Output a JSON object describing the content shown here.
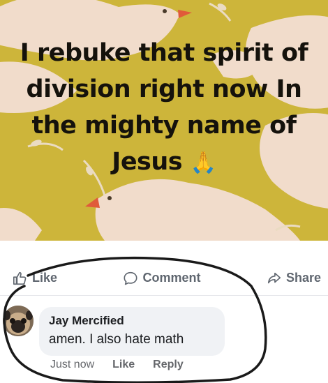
{
  "post": {
    "image_text": "I rebuke that spirit of division right now In the mighty name of Jesus",
    "emoji": "🙏",
    "colors": {
      "background": "#cdb53a",
      "dove": "#f1dccb",
      "beak": "#e05a3a",
      "text": "#15120c"
    }
  },
  "actions": {
    "like": {
      "label": "Like",
      "icon": "thumbs-up-icon"
    },
    "comment": {
      "label": "Comment",
      "icon": "comment-bubble-icon"
    },
    "share": {
      "label": "Share",
      "icon": "share-arrow-icon"
    }
  },
  "comment": {
    "author": "Jay Mercified",
    "text": "amen. I also hate math",
    "time": "Just now",
    "like_label": "Like",
    "reply_label": "Reply"
  },
  "annotation": {
    "color": "#1a1a1a"
  }
}
